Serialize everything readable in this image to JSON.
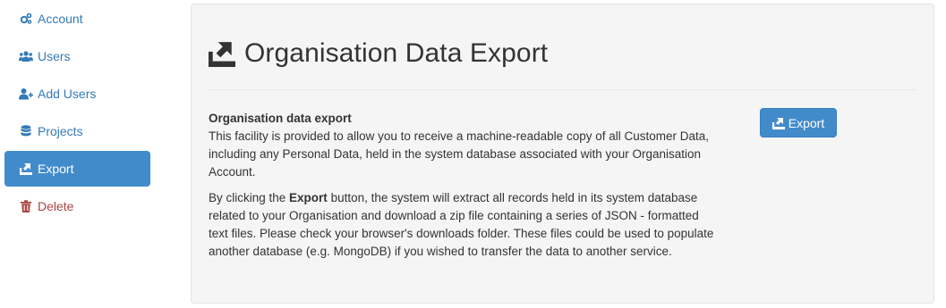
{
  "sidebar": {
    "items": [
      {
        "label": "Account",
        "icon": "cogs-icon"
      },
      {
        "label": "Users",
        "icon": "users-icon"
      },
      {
        "label": "Add Users",
        "icon": "user-plus-icon"
      },
      {
        "label": "Projects",
        "icon": "database-icon"
      },
      {
        "label": "Export",
        "icon": "export-icon",
        "active": true
      },
      {
        "label": "Delete",
        "icon": "trash-icon"
      }
    ]
  },
  "main": {
    "title": "Organisation Data Export",
    "section_heading": "Organisation data export",
    "intro": "This facility is provided to allow you to receive a machine-readable copy of all Customer Data, including any Personal Data, held in the system database associated with your Organisation Account.",
    "body_prefix": "By clicking the ",
    "body_bold": "Export",
    "body_suffix": " button, the system will extract all records held in its system database related to your Organisation and download a zip file containing a series of JSON - formatted text files. Please check your browser's downloads folder. These files could be used to populate another database (e.g. MongoDB) if you wished to transfer the data to another service.",
    "export_button_label": "Export"
  },
  "colors": {
    "link": "#337ab7",
    "active_bg": "#428bca",
    "danger": "#a94442",
    "panel_bg": "#f5f5f5"
  }
}
